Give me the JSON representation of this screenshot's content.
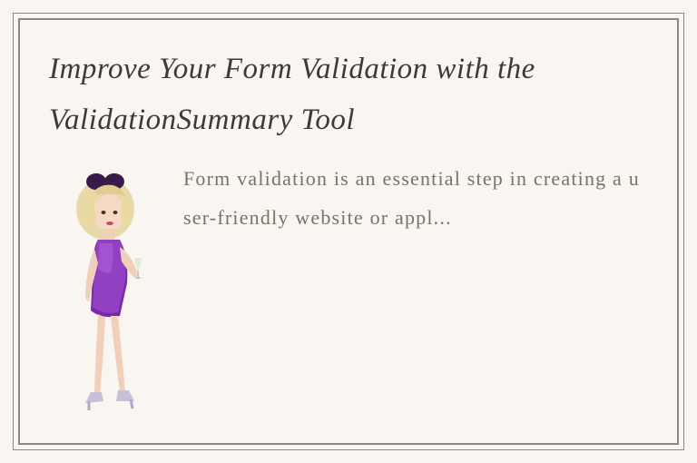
{
  "article": {
    "title": "Improve Your Form Validation with the ValidationSummary Tool",
    "body": "Form validation is an essential step in creating a user-friendly website or appl..."
  },
  "illustration": {
    "name": "woman-in-purple-dress-illustration"
  }
}
